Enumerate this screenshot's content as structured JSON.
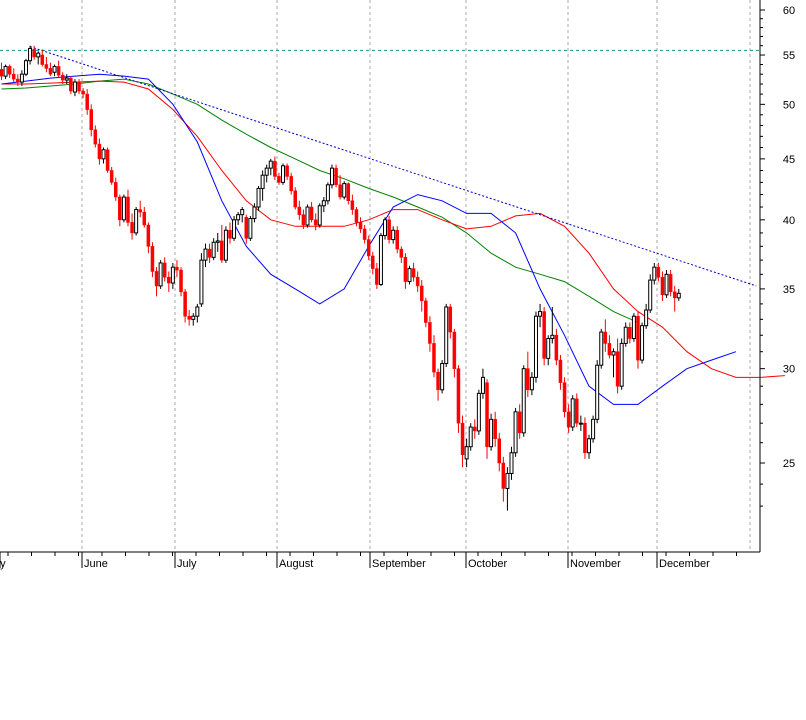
{
  "chart_data": {
    "type": "candlestick",
    "scale": "log",
    "ylim": [
      22,
      61
    ],
    "y_ticks": [
      25,
      30,
      35,
      40,
      45,
      50,
      55,
      60
    ],
    "x_labels": [
      "ay",
      "June",
      "July",
      "August",
      "September",
      "October",
      "November",
      "December"
    ],
    "grid": {
      "vertical": true,
      "horizontal": false
    },
    "colors": {
      "up_body": "#ffffff",
      "up_outline": "#000000",
      "down": "#ff0000",
      "ma_short": "#0000ff",
      "ma_mid": "#ff0000",
      "ma_long": "#008000",
      "trendline": "#0000cc",
      "resistance": "#009999",
      "grid": "#aaaaaa"
    },
    "candles": [
      [
        53.5,
        54.2,
        52.4,
        52.8
      ],
      [
        52.8,
        54.0,
        52.5,
        53.8
      ],
      [
        53.8,
        54.0,
        52.6,
        53.0
      ],
      [
        53.0,
        53.6,
        52.2,
        52.5
      ],
      [
        52.5,
        53.0,
        51.8,
        52.2
      ],
      [
        52.2,
        53.4,
        51.8,
        53.0
      ],
      [
        53.0,
        54.6,
        52.8,
        54.4
      ],
      [
        54.4,
        56.0,
        54.0,
        55.7
      ],
      [
        55.6,
        56.0,
        54.5,
        54.8
      ],
      [
        54.8,
        55.4,
        54.0,
        55.2
      ],
      [
        55.0,
        55.6,
        53.8,
        54.0
      ],
      [
        54.0,
        54.8,
        53.2,
        53.6
      ],
      [
        53.6,
        54.2,
        52.8,
        53.0
      ],
      [
        53.2,
        54.0,
        52.8,
        53.8
      ],
      [
        53.8,
        54.4,
        52.6,
        52.9
      ],
      [
        52.9,
        53.2,
        52.0,
        52.4
      ],
      [
        52.4,
        53.0,
        52.0,
        52.6
      ],
      [
        52.6,
        52.8,
        51.0,
        51.3
      ],
      [
        51.2,
        52.5,
        50.8,
        52.2
      ],
      [
        52.2,
        52.5,
        51.0,
        51.3
      ],
      [
        51.3,
        51.6,
        50.6,
        51.0
      ],
      [
        51.0,
        51.5,
        49.0,
        49.5
      ],
      [
        49.5,
        50.0,
        47.0,
        47.6
      ],
      [
        47.6,
        48.0,
        46.0,
        46.3
      ],
      [
        46.3,
        46.8,
        44.5,
        45.0
      ],
      [
        45.0,
        46.0,
        44.6,
        45.8
      ],
      [
        45.8,
        46.0,
        43.8,
        44.0
      ],
      [
        44.0,
        44.3,
        42.8,
        43.0
      ],
      [
        43.0,
        43.4,
        41.5,
        41.8
      ],
      [
        41.8,
        42.0,
        39.5,
        40.0
      ],
      [
        40.0,
        42.0,
        39.8,
        41.8
      ],
      [
        41.8,
        42.4,
        39.5,
        39.8
      ],
      [
        39.8,
        40.5,
        38.5,
        39.0
      ],
      [
        39.0,
        41.0,
        38.8,
        40.8
      ],
      [
        40.8,
        41.5,
        40.2,
        40.6
      ],
      [
        40.6,
        41.0,
        39.4,
        39.6
      ],
      [
        39.6,
        39.8,
        37.5,
        38.0
      ],
      [
        38.0,
        38.3,
        35.8,
        36.2
      ],
      [
        36.2,
        36.5,
        34.5,
        35.2
      ],
      [
        35.2,
        37.0,
        35.0,
        36.8
      ],
      [
        36.8,
        37.2,
        35.5,
        35.8
      ],
      [
        35.8,
        36.2,
        34.8,
        35.4
      ],
      [
        35.4,
        36.8,
        35.0,
        36.5
      ],
      [
        36.5,
        37.0,
        35.8,
        36.3
      ],
      [
        36.3,
        36.5,
        34.5,
        34.8
      ],
      [
        34.8,
        35.0,
        32.8,
        33.2
      ],
      [
        33.2,
        33.6,
        32.6,
        33.0
      ],
      [
        33.0,
        33.4,
        32.6,
        33.2
      ],
      [
        33.2,
        34.0,
        32.8,
        33.8
      ],
      [
        34.0,
        37.5,
        33.8,
        37.0
      ],
      [
        37.0,
        38.2,
        36.5,
        37.8
      ],
      [
        37.8,
        38.2,
        36.8,
        37.2
      ],
      [
        37.2,
        38.6,
        37.0,
        38.3
      ],
      [
        38.3,
        39.0,
        37.6,
        38.4
      ],
      [
        38.4,
        39.6,
        36.8,
        37.0
      ],
      [
        37.0,
        39.5,
        36.8,
        39.2
      ],
      [
        39.2,
        39.8,
        38.2,
        38.6
      ],
      [
        38.6,
        40.3,
        38.4,
        40.0
      ],
      [
        40.0,
        40.6,
        39.6,
        40.4
      ],
      [
        40.4,
        41.0,
        39.8,
        40.8
      ],
      [
        40.2,
        40.4,
        38.2,
        38.6
      ],
      [
        38.6,
        40.3,
        38.4,
        40.1
      ],
      [
        40.1,
        41.3,
        39.8,
        41.0
      ],
      [
        41.0,
        42.7,
        40.7,
        42.5
      ],
      [
        42.5,
        44.0,
        41.5,
        43.6
      ],
      [
        43.6,
        44.5,
        43.0,
        44.2
      ],
      [
        44.2,
        45.0,
        43.6,
        44.8
      ],
      [
        44.8,
        45.2,
        43.2,
        43.5
      ],
      [
        43.5,
        43.8,
        42.8,
        43.0
      ],
      [
        43.0,
        44.6,
        42.8,
        44.4
      ],
      [
        44.4,
        44.6,
        43.2,
        43.5
      ],
      [
        43.5,
        43.8,
        42.0,
        42.3
      ],
      [
        42.3,
        42.6,
        40.8,
        41.0
      ],
      [
        41.0,
        41.5,
        40.0,
        40.4
      ],
      [
        40.4,
        40.8,
        39.3,
        39.6
      ],
      [
        39.6,
        41.2,
        39.4,
        41.0
      ],
      [
        41.0,
        41.4,
        39.8,
        40.0
      ],
      [
        40.0,
        40.5,
        39.2,
        39.6
      ],
      [
        39.6,
        41.3,
        39.4,
        41.1
      ],
      [
        41.1,
        41.8,
        40.6,
        41.5
      ],
      [
        41.5,
        43.0,
        41.2,
        42.8
      ],
      [
        42.8,
        44.5,
        42.5,
        44.2
      ],
      [
        44.2,
        44.5,
        42.6,
        42.8
      ],
      [
        42.8,
        43.6,
        41.6,
        41.8
      ],
      [
        41.8,
        43.1,
        41.6,
        42.9
      ],
      [
        42.9,
        43.0,
        41.2,
        41.5
      ],
      [
        41.5,
        42.0,
        40.4,
        40.8
      ],
      [
        40.8,
        41.0,
        39.5,
        39.8
      ],
      [
        39.8,
        40.2,
        39.0,
        39.3
      ],
      [
        39.3,
        39.6,
        38.2,
        38.5
      ],
      [
        38.5,
        38.8,
        37.0,
        37.3
      ],
      [
        37.3,
        37.6,
        36.0,
        36.4
      ],
      [
        36.4,
        36.8,
        35.0,
        35.3
      ],
      [
        35.3,
        39.0,
        35.2,
        38.8
      ],
      [
        38.8,
        40.2,
        38.5,
        40.0
      ],
      [
        40.0,
        40.3,
        38.2,
        38.5
      ],
      [
        38.5,
        39.5,
        38.2,
        39.2
      ],
      [
        39.2,
        39.5,
        37.5,
        37.8
      ],
      [
        37.8,
        38.0,
        36.8,
        37.2
      ],
      [
        37.2,
        37.5,
        35.0,
        35.5
      ],
      [
        35.5,
        36.6,
        35.3,
        36.4
      ],
      [
        36.4,
        36.8,
        35.5,
        35.8
      ],
      [
        35.8,
        36.2,
        34.8,
        35.2
      ],
      [
        35.2,
        35.6,
        33.5,
        34.2
      ],
      [
        34.2,
        34.4,
        32.5,
        32.8
      ],
      [
        32.8,
        33.2,
        31.0,
        31.5
      ],
      [
        31.5,
        32.0,
        29.5,
        29.8
      ],
      [
        29.8,
        30.0,
        28.2,
        28.8
      ],
      [
        28.8,
        30.5,
        28.6,
        30.3
      ],
      [
        30.3,
        34.0,
        30.1,
        33.8
      ],
      [
        33.8,
        34.0,
        31.8,
        32.2
      ],
      [
        32.2,
        32.4,
        29.5,
        30.0
      ],
      [
        30.0,
        30.2,
        26.5,
        27.0
      ],
      [
        27.0,
        27.4,
        24.8,
        25.4
      ],
      [
        25.2,
        26.2,
        24.8,
        25.8
      ],
      [
        25.8,
        27.0,
        25.6,
        26.8
      ],
      [
        26.8,
        27.2,
        26.2,
        26.6
      ],
      [
        26.6,
        28.8,
        26.4,
        28.6
      ],
      [
        28.6,
        30.0,
        28.3,
        29.5
      ],
      [
        29.2,
        29.4,
        25.2,
        25.8
      ],
      [
        25.8,
        27.5,
        25.6,
        27.2
      ],
      [
        27.2,
        27.6,
        25.8,
        26.2
      ],
      [
        26.2,
        26.5,
        24.6,
        25.0
      ],
      [
        25.0,
        25.3,
        23.2,
        23.8
      ],
      [
        23.8,
        24.8,
        22.8,
        24.5
      ],
      [
        24.5,
        25.8,
        24.2,
        25.5
      ],
      [
        25.5,
        27.8,
        25.3,
        27.6
      ],
      [
        27.6,
        28.0,
        26.2,
        26.5
      ],
      [
        26.5,
        30.2,
        26.3,
        30.0
      ],
      [
        30.0,
        31.0,
        28.4,
        28.8
      ],
      [
        28.8,
        29.8,
        28.5,
        29.5
      ],
      [
        29.5,
        33.5,
        29.2,
        33.2
      ],
      [
        33.2,
        34.0,
        32.5,
        33.5
      ],
      [
        33.5,
        33.8,
        30.2,
        30.6
      ],
      [
        30.6,
        32.0,
        30.2,
        31.8
      ],
      [
        31.8,
        33.8,
        31.5,
        32.0
      ],
      [
        32.0,
        32.4,
        30.2,
        30.5
      ],
      [
        30.5,
        30.8,
        28.8,
        29.2
      ],
      [
        29.2,
        29.5,
        27.3,
        27.6
      ],
      [
        27.6,
        28.0,
        26.5,
        26.8
      ],
      [
        26.8,
        28.5,
        26.6,
        28.3
      ],
      [
        28.3,
        28.6,
        26.8,
        27.0
      ],
      [
        27.0,
        27.4,
        26.6,
        27.0
      ],
      [
        27.0,
        27.3,
        25.2,
        25.5
      ],
      [
        25.5,
        26.4,
        25.2,
        26.2
      ],
      [
        26.2,
        27.4,
        26.0,
        27.2
      ],
      [
        27.2,
        30.5,
        27.0,
        30.2
      ],
      [
        30.2,
        32.4,
        30.0,
        32.2
      ],
      [
        32.2,
        33.0,
        31.0,
        31.5
      ],
      [
        31.5,
        32.0,
        30.6,
        30.8
      ],
      [
        30.8,
        31.2,
        29.5,
        31.0
      ],
      [
        31.0,
        31.8,
        28.6,
        29.0
      ],
      [
        29.0,
        31.8,
        28.8,
        31.5
      ],
      [
        31.5,
        32.8,
        31.3,
        32.5
      ],
      [
        32.5,
        32.8,
        31.5,
        31.8
      ],
      [
        31.8,
        33.4,
        31.6,
        33.2
      ],
      [
        33.2,
        33.5,
        30.0,
        30.5
      ],
      [
        30.5,
        32.8,
        30.3,
        32.6
      ],
      [
        32.6,
        34.0,
        32.4,
        33.6
      ],
      [
        33.6,
        36.0,
        33.4,
        35.6
      ],
      [
        35.6,
        36.8,
        35.3,
        36.5
      ],
      [
        36.5,
        36.8,
        35.5,
        35.8
      ],
      [
        35.8,
        36.2,
        34.2,
        34.6
      ],
      [
        34.6,
        36.3,
        34.4,
        36.0
      ],
      [
        36.0,
        36.3,
        34.5,
        34.8
      ],
      [
        34.8,
        35.2,
        33.5,
        34.4
      ],
      [
        34.4,
        35.0,
        34.2,
        34.7
      ]
    ],
    "moving_averages": {
      "short": [
        52.0,
        52.3,
        52.6,
        52.8,
        53.0,
        52.8,
        52.5,
        50.0,
        46.5,
        41.5,
        38.0,
        36.0,
        35.0,
        34.0,
        35.0,
        38.0,
        41.0,
        42.0,
        41.5,
        40.5,
        40.5,
        39.0,
        35.0,
        32.0,
        29.0,
        28.0,
        28.0,
        29.0,
        30.0,
        30.5,
        31.0
      ],
      "mid": [
        52.0,
        52.0,
        52.1,
        52.2,
        52.3,
        52.2,
        51.5,
        49.5,
        47.0,
        44.0,
        41.5,
        40.0,
        39.5,
        39.5,
        39.5,
        40.0,
        40.8,
        40.8,
        40.0,
        39.3,
        39.5,
        40.3,
        40.5,
        39.5,
        37.5,
        35.0,
        33.5,
        32.5,
        31.0,
        30.0,
        29.5,
        29.5,
        29.6
      ],
      "long": [
        51.5,
        51.6,
        51.8,
        52.0,
        52.3,
        52.5,
        52.0,
        51.0,
        50.0,
        48.5,
        47.2,
        46.0,
        45.0,
        44.0,
        43.3,
        42.5,
        41.8,
        41.0,
        40.2,
        39.0,
        37.5,
        36.5,
        36.0,
        35.5,
        34.5,
        33.5,
        32.8
      ]
    },
    "trendline": [
      [
        7,
        55.9
      ],
      [
        185,
        35.2
      ]
    ],
    "resistance_level": 55.5
  }
}
